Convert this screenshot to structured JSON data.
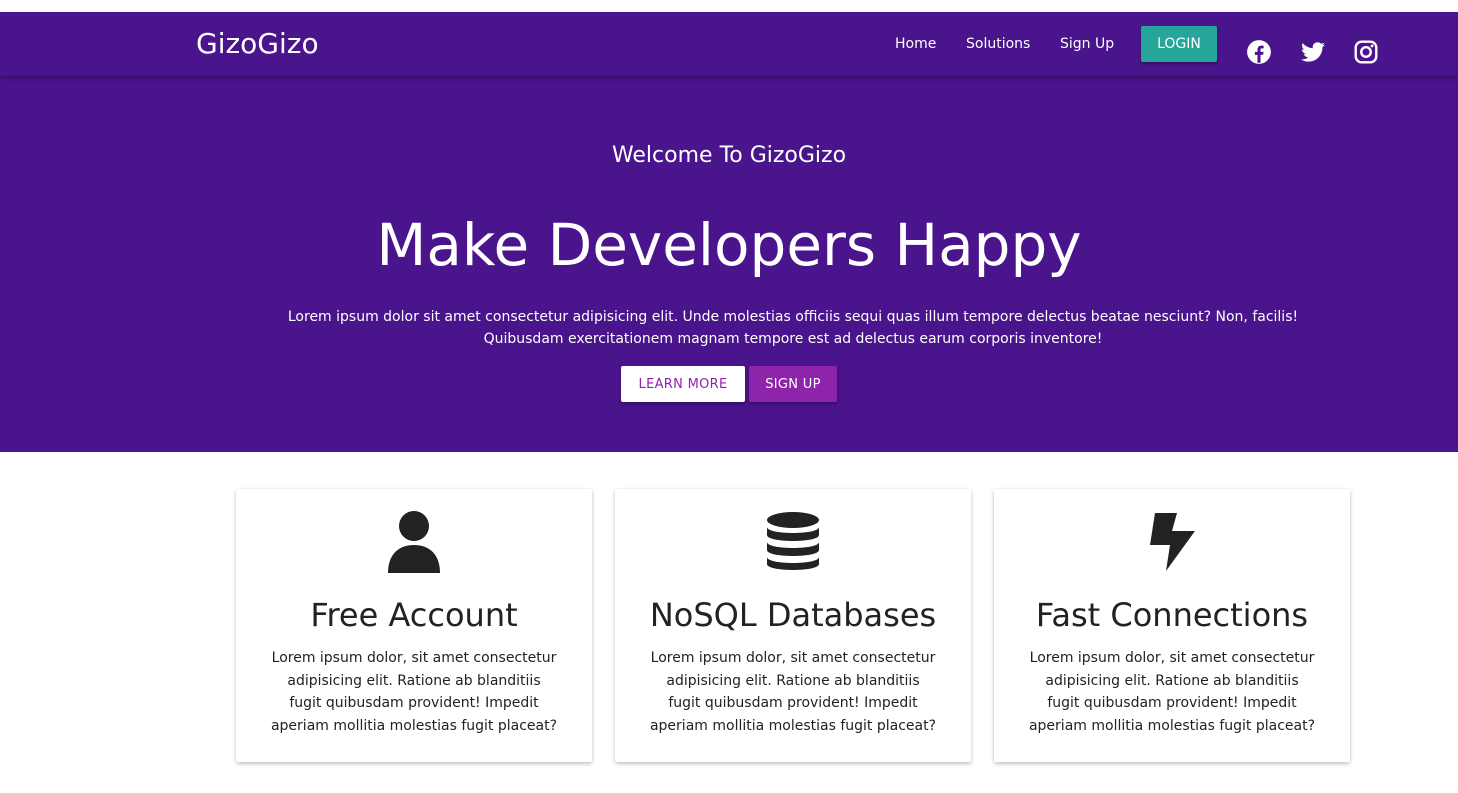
{
  "nav": {
    "brand": "GizoGizo",
    "links": [
      "Home",
      "Solutions",
      "Sign Up"
    ],
    "login_label": "LOGIN",
    "social_icons": [
      "facebook-icon",
      "twitter-icon",
      "instagram-icon"
    ]
  },
  "hero": {
    "welcome": "Welcome To GizoGizo",
    "title": "Make Developers Happy",
    "description": "Lorem ipsum dolor sit amet consectetur adipisicing elit. Unde molestias officiis sequi quas illum tempore delectus beatae nesciunt? Non, facilis! Quibusdam exercitationem magnam tempore est ad delectus earum corporis inventore!",
    "learn_more_label": "LEARN MORE",
    "sign_up_label": "SIGN UP"
  },
  "features": [
    {
      "icon": "user-icon",
      "title": "Free Account",
      "text": "Lorem ipsum dolor, sit amet consectetur adipisicing elit. Ratione ab blanditiis fugit quibusdam provident! Impedit aperiam mollitia molestias fugit placeat?"
    },
    {
      "icon": "database-icon",
      "title": "NoSQL Databases",
      "text": "Lorem ipsum dolor, sit amet consectetur adipisicing elit. Ratione ab blanditiis fugit quibusdam provident! Impedit aperiam mollitia molestias fugit placeat?"
    },
    {
      "icon": "bolt-icon",
      "title": "Fast Connections",
      "text": "Lorem ipsum dolor, sit amet consectetur adipisicing elit. Ratione ab blanditiis fugit quibusdam provident! Impedit aperiam mollitia molestias fugit placeat?"
    }
  ],
  "colors": {
    "primary": "#4a148c",
    "accent": "#26a69a",
    "secondary": "#8e24aa",
    "text_dark": "#222222"
  }
}
